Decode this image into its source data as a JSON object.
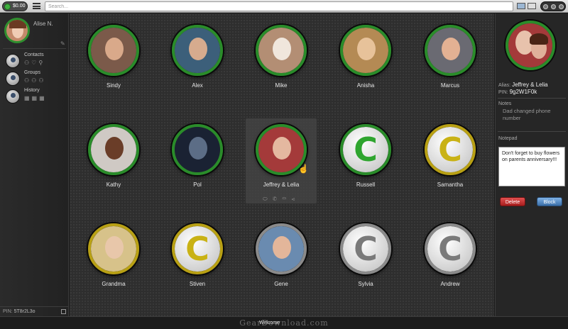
{
  "topbar": {
    "balance": "$0.00",
    "search_placeholder": "Search..."
  },
  "sidebar": {
    "user_name": "Alise N.",
    "sections": [
      {
        "label": "Contacts",
        "icon": "contacts-icon"
      },
      {
        "label": "Groups",
        "icon": "groups-icon"
      },
      {
        "label": "History",
        "icon": "history-icon"
      }
    ],
    "pin_label": "PIN:",
    "pin_value": "5T8r2L3o"
  },
  "contacts": [
    {
      "name": "Sindy",
      "ring": "green",
      "kind": "photo",
      "skin": "#d9a98a",
      "bg": "#7b5a4a"
    },
    {
      "name": "Alex",
      "ring": "green",
      "kind": "photo",
      "skin": "#d6ab8e",
      "bg": "#3c5f7a"
    },
    {
      "name": "Mike",
      "ring": "green",
      "kind": "photo",
      "skin": "#f0e6dc",
      "bg": "#b38e74"
    },
    {
      "name": "Anisha",
      "ring": "green",
      "kind": "photo",
      "skin": "#e7c29a",
      "bg": "#b48a54"
    },
    {
      "name": "Marcus",
      "ring": "green",
      "kind": "photo",
      "skin": "#e3b193",
      "bg": "#6a6a72"
    },
    {
      "name": "Kathy",
      "ring": "green",
      "kind": "photo",
      "skin": "#6a3d28",
      "bg": "#cfc9c4"
    },
    {
      "name": "Pol",
      "ring": "green",
      "kind": "photo",
      "skin": "#5c6d86",
      "bg": "#1a2233"
    },
    {
      "name": "Jeffrey & Lelia",
      "ring": "green",
      "kind": "photo",
      "skin": "#e4b8a0",
      "bg": "#a43a3a",
      "selected": true
    },
    {
      "name": "Russell",
      "ring": "green",
      "kind": "logo",
      "letter": "C",
      "color": "#2fa52f"
    },
    {
      "name": "Samantha",
      "ring": "gold",
      "kind": "logo",
      "letter": "C",
      "color": "#c9b215"
    },
    {
      "name": "Grandma",
      "ring": "gold",
      "kind": "photo",
      "skin": "#e8c7aa",
      "bg": "#d7c28a"
    },
    {
      "name": "Stiven",
      "ring": "gold",
      "kind": "logo",
      "letter": "C",
      "color": "#c9b215"
    },
    {
      "name": "Gene",
      "ring": "grey",
      "kind": "photo",
      "skin": "#e3b69a",
      "bg": "#6a8bb0"
    },
    {
      "name": "Sylvia",
      "ring": "grey",
      "kind": "logo",
      "letter": "C",
      "color": "#7a7a7a"
    },
    {
      "name": "Andrew",
      "ring": "grey",
      "kind": "logo",
      "letter": "C",
      "color": "#7a7a7a"
    }
  ],
  "selected_actions": [
    "chat-icon",
    "phone-icon",
    "video-icon",
    "share-icon"
  ],
  "right_panel": {
    "alias_label": "Alias:",
    "alias_value": "Jeffrey & Lelia",
    "pin_label": "PIN:",
    "pin_value": "9g2W1F0k",
    "notes_label": "Notes",
    "notes_text": "Dad changed phone number",
    "notepad_label": "Notepad",
    "notepad_text": "Don't forget to buy flowers on parents anniversary!!!",
    "delete_label": "Delete",
    "block_label": "Block"
  },
  "bottom": {
    "welcome": "Welcome",
    "watermark": "GearDownload.com"
  }
}
